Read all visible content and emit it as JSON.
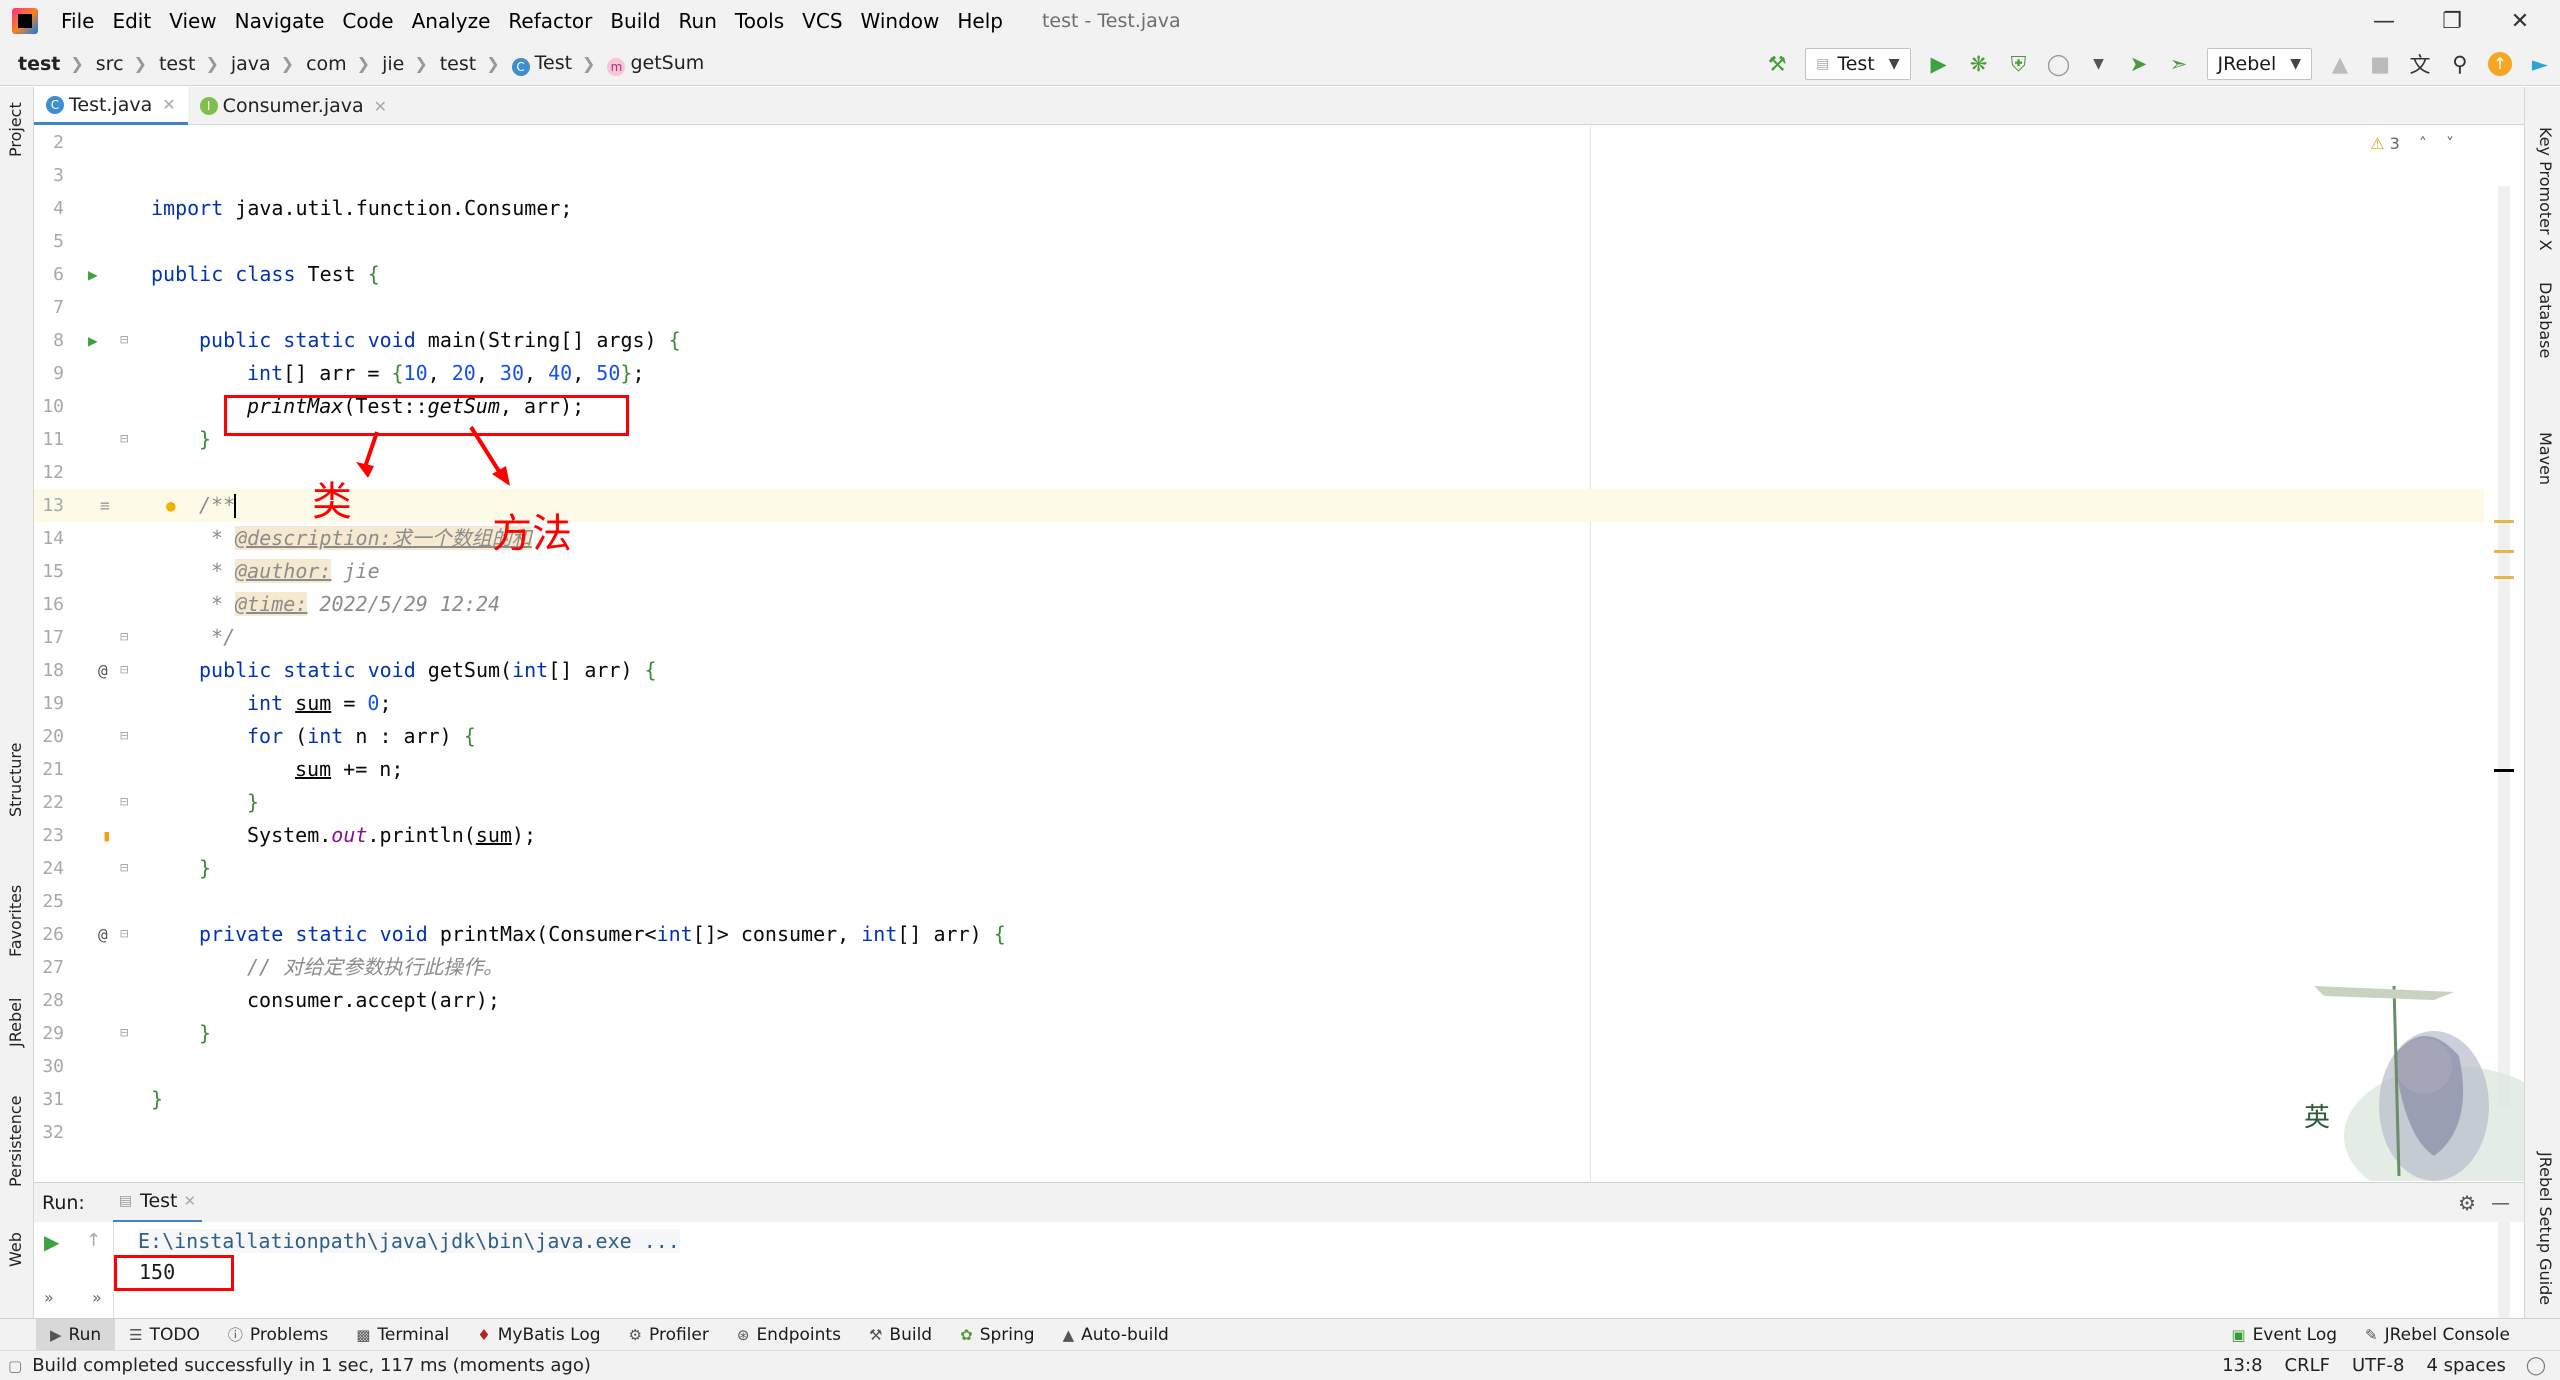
{
  "menu": [
    "File",
    "Edit",
    "View",
    "Navigate",
    "Code",
    "Analyze",
    "Refactor",
    "Build",
    "Run",
    "Tools",
    "VCS",
    "Window",
    "Help"
  ],
  "window_title": "test - Test.java",
  "breadcrumb": [
    "test",
    "src",
    "test",
    "java",
    "com",
    "jie",
    "test",
    "Test",
    "getSum"
  ],
  "run_config": "Test",
  "jrebel_config": "JRebel",
  "tabs": [
    {
      "label": "Test.java",
      "active": true
    },
    {
      "label": "Consumer.java",
      "active": false
    }
  ],
  "left_tools": [
    "Project",
    "Structure",
    "Favorites",
    "JRebel",
    "Persistence",
    "Web"
  ],
  "right_tools": [
    "Key Promoter X",
    "Database",
    "Maven",
    "JRebel Setup Guide"
  ],
  "warnings": "3",
  "code": {
    "l2": "",
    "l3": "",
    "l4_kw": "import",
    "l4_rest": " java.util.function.Consumer;",
    "l5": "",
    "l6_kw": "public class",
    "l6_name": " Test ",
    "l6_brace": "{",
    "l7": "",
    "l8_kw": "public static void",
    "l8_rest": " main(String[] args) ",
    "l8_brace": "{",
    "l9_kw": "int",
    "l9_a": "[] arr = ",
    "l9_b": "{",
    "l9_nums": [
      "10",
      "20",
      "30",
      "40",
      "50"
    ],
    "l9_c": "}",
    "l9_end": ";",
    "l10_call": "printMax",
    "l10_a": "(Test::",
    "l10_m": "getSum",
    "l10_b": ", arr);",
    "l11": "}",
    "l12": "",
    "l13": "/**",
    "l14_star": " * ",
    "l14_tag": "@description:",
    "l14_text": "求一个数组的和",
    "l15_star": " * ",
    "l15_tag": "@author:",
    "l15_text": " jie",
    "l16_star": " * ",
    "l16_tag": "@time:",
    "l16_text": " 2022/5/29 12:24",
    "l17": " */",
    "l18_kw": "public static void",
    "l18_a": " getSum(",
    "l18_kw2": "int",
    "l18_b": "[] arr) ",
    "l18_brace": "{",
    "l19_kw": "int",
    "l19_sum": "sum",
    "l19_a": " = ",
    "l19_num": "0",
    "l19_end": ";",
    "l20_kw": "for",
    "l20_a": " (",
    "l20_kw2": "int",
    "l20_b": " n : arr) ",
    "l20_brace": "{",
    "l21_sum": "sum",
    "l21_a": " += n;",
    "l22": "}",
    "l23_a": "System.",
    "l23_out": "out",
    "l23_b": ".println(",
    "l23_sum": "sum",
    "l23_c": ");",
    "l24": "}",
    "l25": "",
    "l26_kw": "private static void",
    "l26_a": " printMax(Consumer<",
    "l26_kw2": "int",
    "l26_b": "[]> consumer, ",
    "l26_kw3": "int",
    "l26_c": "[] arr) ",
    "l26_brace": "{",
    "l27": "// 对给定参数执行此操作。",
    "l28": "consumer.accept(arr);",
    "l29": "}",
    "l30": "",
    "l31": "}",
    "l32": ""
  },
  "line_numbers": [
    "2",
    "3",
    "4",
    "5",
    "6",
    "7",
    "8",
    "9",
    "10",
    "11",
    "12",
    "13",
    "14",
    "15",
    "16",
    "17",
    "18",
    "19",
    "20",
    "21",
    "22",
    "23",
    "24",
    "25",
    "26",
    "27",
    "28",
    "29",
    "30",
    "31",
    "32"
  ],
  "annotations": {
    "class_label": "类",
    "method_label": "方法"
  },
  "run_panel": {
    "title": "Run:",
    "tab": "Test",
    "command": "E:\\installationpath\\java\\jdk\\bin\\java.exe ...",
    "output": "150"
  },
  "bottom_tools": [
    {
      "label": "Run",
      "icon": "play-icon"
    },
    {
      "label": "TODO",
      "icon": "list-icon"
    },
    {
      "label": "Problems",
      "icon": "info-icon"
    },
    {
      "label": "Terminal",
      "icon": "terminal-icon"
    },
    {
      "label": "MyBatis Log",
      "icon": "bird-icon"
    },
    {
      "label": "Profiler",
      "icon": "profiler-icon"
    },
    {
      "label": "Endpoints",
      "icon": "endpoints-icon"
    },
    {
      "label": "Build",
      "icon": "hammer-icon"
    },
    {
      "label": "Spring",
      "icon": "spring-icon"
    },
    {
      "label": "Auto-build",
      "icon": "warning-icon"
    }
  ],
  "bottom_right_tools": [
    {
      "label": "Event Log",
      "icon": "event-log-icon"
    },
    {
      "label": "JRebel Console",
      "icon": "jrebel-icon"
    }
  ],
  "status": {
    "message": "Build completed successfully in 1 sec, 117 ms (moments ago)",
    "position": "13:8",
    "line_sep": "CRLF",
    "encoding": "UTF-8",
    "indent": "4 spaces"
  },
  "colors": {
    "accent": "#4083c9",
    "annotation": "#ff0000",
    "keyword": "#0033b3",
    "number": "#1750eb"
  }
}
